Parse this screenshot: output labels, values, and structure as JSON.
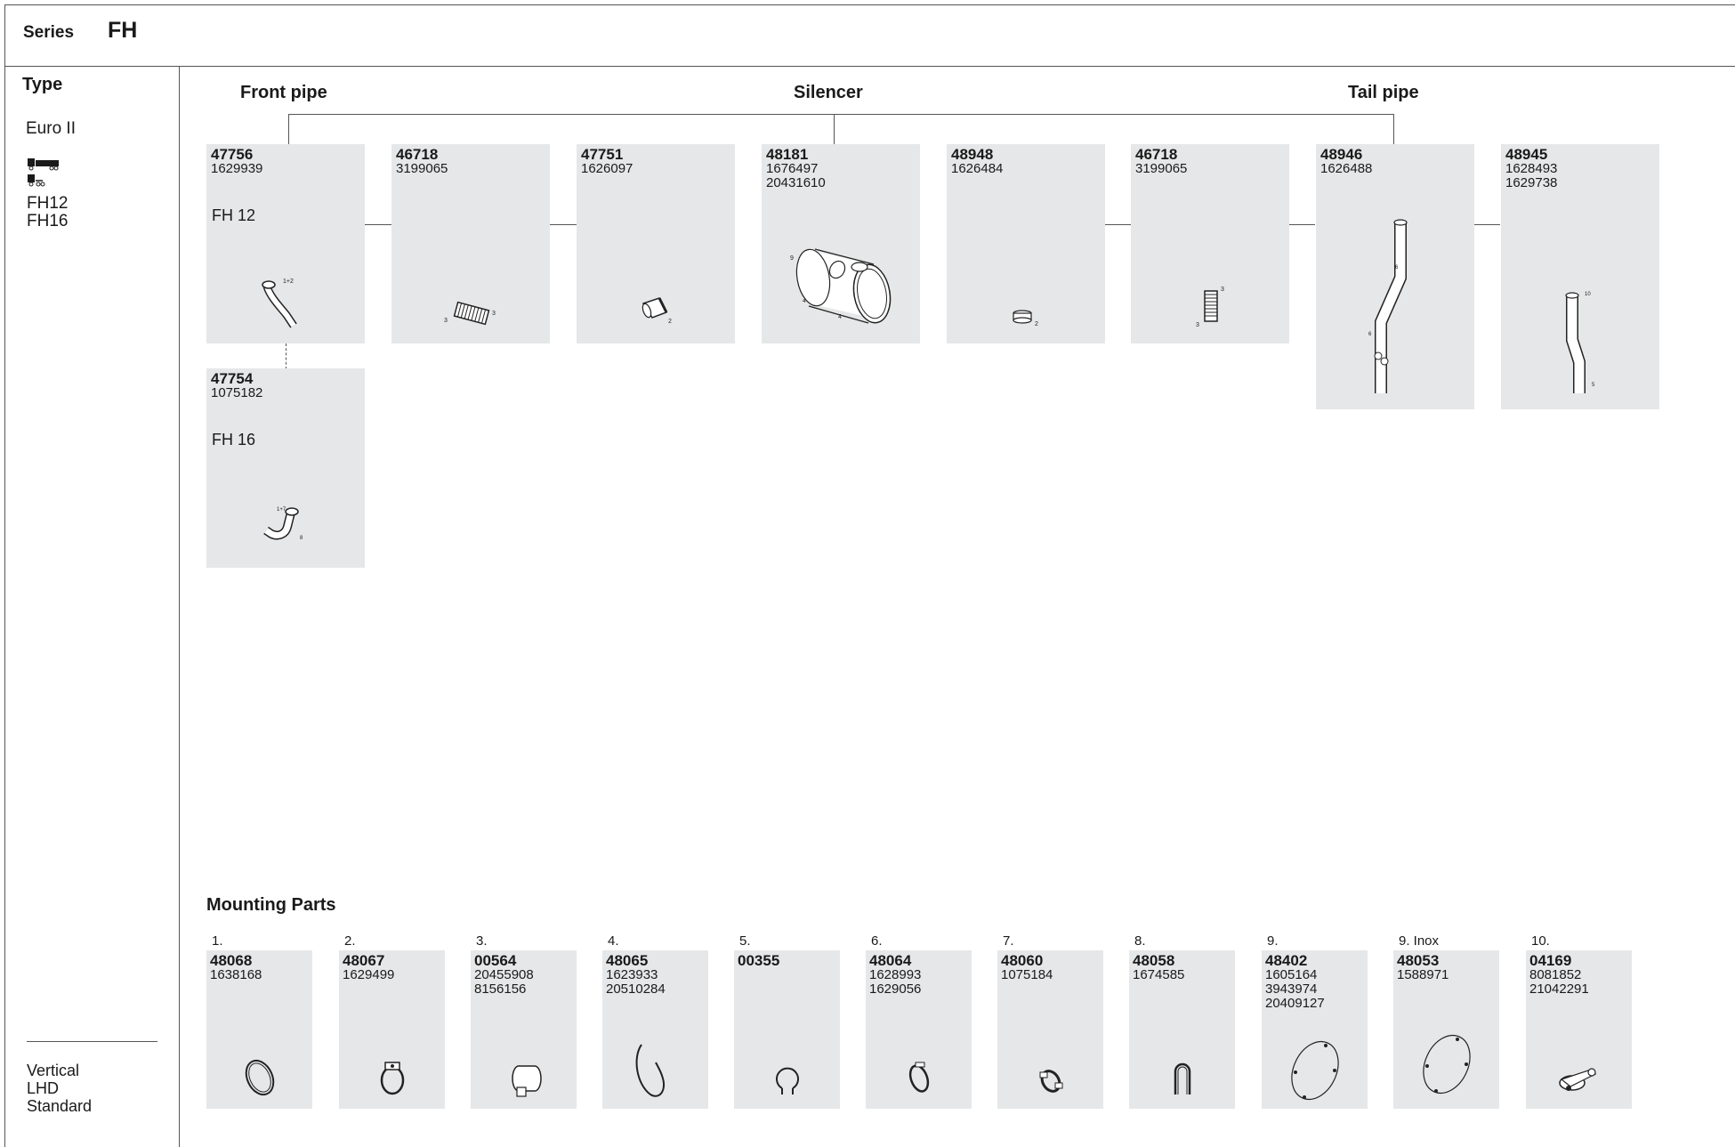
{
  "header": {
    "series_label": "Series",
    "series_value": "FH"
  },
  "sidebar": {
    "type_label": "Type",
    "euro": "Euro II",
    "models": [
      "FH12",
      "FH16"
    ],
    "footer": [
      "Vertical",
      "LHD",
      "Standard"
    ]
  },
  "sections": {
    "front_pipe": "Front pipe",
    "silencer": "Silencer",
    "tail_pipe": "Tail pipe",
    "mounting": "Mounting Parts"
  },
  "parts": [
    {
      "code": "47756",
      "refs": [
        "1629939"
      ],
      "note": "FH 12",
      "callouts": [
        "1+2"
      ]
    },
    {
      "code": "46718",
      "refs": [
        "3199065"
      ],
      "callouts": [
        "3",
        "3"
      ]
    },
    {
      "code": "47751",
      "refs": [
        "1626097"
      ],
      "callouts": [
        "2"
      ]
    },
    {
      "code": "48181",
      "refs": [
        "1676497",
        "20431610"
      ],
      "callouts": [
        "9",
        "4",
        "4"
      ]
    },
    {
      "code": "48948",
      "refs": [
        "1626484"
      ],
      "callouts": [
        "2"
      ]
    },
    {
      "code": "46718",
      "refs": [
        "3199065"
      ],
      "callouts": [
        "3",
        "3"
      ]
    },
    {
      "code": "48946",
      "refs": [
        "1626488"
      ],
      "callouts": [
        "6",
        "6"
      ]
    },
    {
      "code": "48945",
      "refs": [
        "1628493",
        "1629738"
      ],
      "callouts": [
        "10",
        "5"
      ]
    },
    {
      "code": "47754",
      "refs": [
        "1075182"
      ],
      "note": "FH 16",
      "callouts": [
        "1+7",
        "8"
      ]
    }
  ],
  "mounting": [
    {
      "num": "1.",
      "code": "48068",
      "refs": [
        "1638168"
      ]
    },
    {
      "num": "2.",
      "code": "48067",
      "refs": [
        "1629499"
      ]
    },
    {
      "num": "3.",
      "code": "00564",
      "refs": [
        "20455908",
        "8156156"
      ]
    },
    {
      "num": "4.",
      "code": "48065",
      "refs": [
        "1623933",
        "20510284"
      ]
    },
    {
      "num": "5.",
      "code": "00355",
      "refs": []
    },
    {
      "num": "6.",
      "code": "48064",
      "refs": [
        "1628993",
        "1629056"
      ]
    },
    {
      "num": "7.",
      "code": "48060",
      "refs": [
        "1075184"
      ]
    },
    {
      "num": "8.",
      "code": "48058",
      "refs": [
        "1674585"
      ]
    },
    {
      "num": "9.",
      "code": "48402",
      "refs": [
        "1605164",
        "3943974",
        "20409127"
      ]
    },
    {
      "num": "9. Inox",
      "code": "48053",
      "refs": [
        "1588971"
      ]
    },
    {
      "num": "10.",
      "code": "04169",
      "refs": [
        "8081852",
        "21042291"
      ]
    }
  ]
}
